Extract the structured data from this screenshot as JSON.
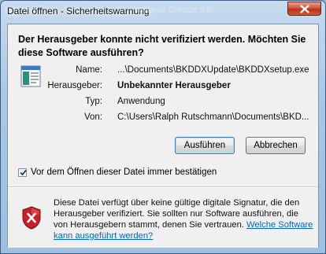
{
  "window": {
    "title": "Datei öffnen - Sicherheitswarnung",
    "ghost_title": "Website Creator 5.6"
  },
  "main": {
    "question": "Der Herausgeber konnte nicht verifiziert werden. Möchten Sie diese Software ausführen?",
    "details": [
      {
        "label": "Name:",
        "value": "...\\Documents\\BKDDXUpdate\\BKDDXsetup.exe",
        "bold": false
      },
      {
        "label": "Herausgeber:",
        "value": "Unbekannter Herausgeber",
        "bold": true
      },
      {
        "label": "Typ:",
        "value": "Anwendung",
        "bold": false
      },
      {
        "label": "Von:",
        "value": "C:\\Users\\Ralph Rutschmann\\Documents\\BKD...",
        "bold": false
      }
    ],
    "buttons": {
      "run": "Ausführen",
      "cancel": "Abbrechen"
    },
    "checkbox": {
      "label": "Vor dem Öffnen dieser Datei immer bestätigen",
      "checked": true
    }
  },
  "footer": {
    "warning": "Diese Datei verfügt über keine gültige digitale Signatur, die den Herausgeber verifiziert. Sie sollten nur Software ausführen, die von Herausgebern stammt, denen Sie vertrauen. ",
    "link": "Welche Software kann ausgeführt werden?"
  },
  "colors": {
    "link": "#0066cc",
    "close_button": "#c9452b",
    "shield": "#c8202a"
  },
  "icons": {
    "close": "close-icon",
    "file": "application-file-icon",
    "shield": "security-shield-error-icon",
    "check": "checkmark-icon"
  }
}
